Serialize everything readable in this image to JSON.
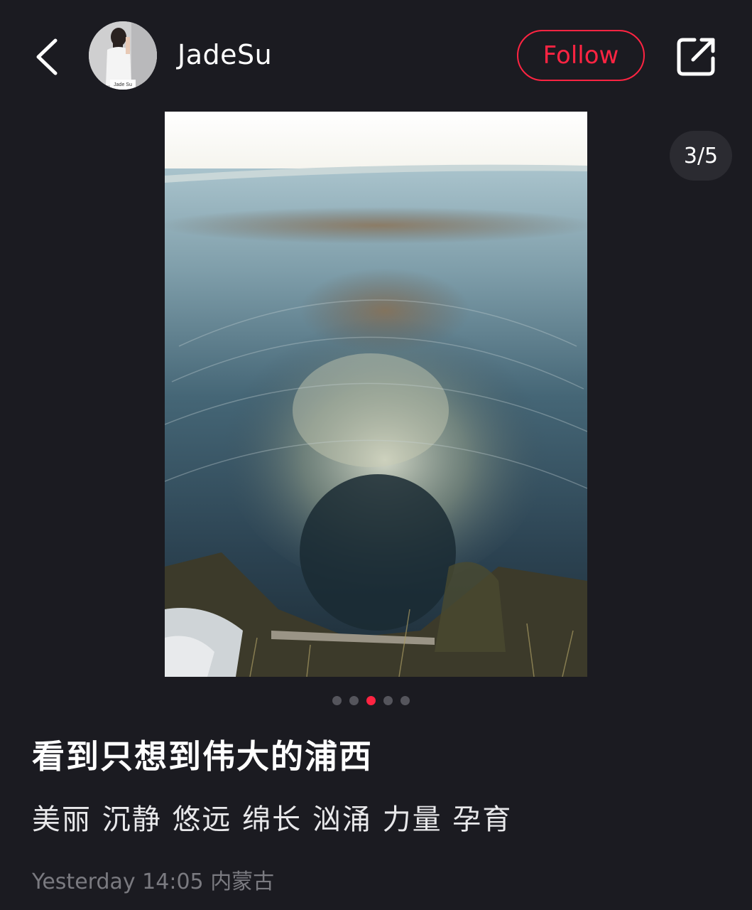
{
  "header": {
    "username": "JadeSu",
    "follow_label": "Follow"
  },
  "avatar": {
    "caption": "Jade Su"
  },
  "carousel": {
    "counter": "3/5",
    "current": 3,
    "total": 5
  },
  "post": {
    "title": "看到只想到伟大的浦西",
    "description": "美丽 沉静 悠远 绵长 汹涌 力量 孕育",
    "timestamp": "Yesterday 14:05",
    "location": "内蒙古"
  },
  "icons": {
    "back": "chevron-left-icon",
    "share": "share-external-icon"
  },
  "colors": {
    "accent": "#ff2442",
    "background": "#1b1b21",
    "muted_text": "#7a7a80"
  }
}
